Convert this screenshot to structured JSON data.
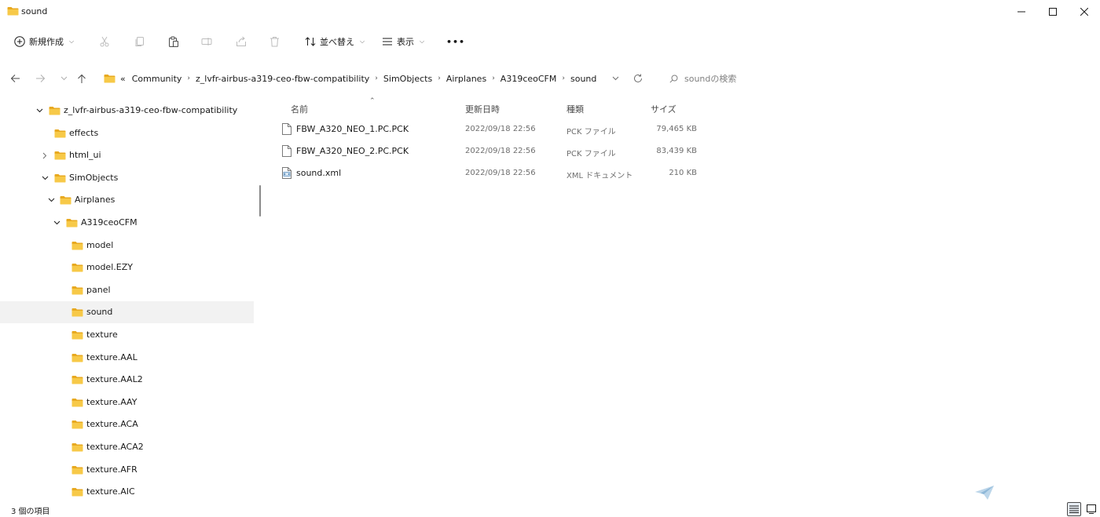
{
  "window": {
    "title": "sound",
    "controls": {
      "minimize": "minimize-icon",
      "maximize": "maximize-icon",
      "close": "close-icon"
    }
  },
  "toolbar": {
    "new_label": "新規作成",
    "sort_label": "並べ替え",
    "view_label": "表示",
    "more_label": "•••"
  },
  "address": {
    "crumbs": [
      "«",
      "Community",
      "z_lvfr-airbus-a319-ceo-fbw-compatibility",
      "SimObjects",
      "Airplanes",
      "A319ceoCFM",
      "sound"
    ],
    "search_placeholder": "soundの検索"
  },
  "nav_tree": [
    {
      "label": "z_lvfr-airbus-a319-ceo-fbw-compatibility",
      "depth": 0,
      "expander": "down"
    },
    {
      "label": "effects",
      "depth": 1,
      "expander": "none"
    },
    {
      "label": "html_ui",
      "depth": 1,
      "expander": "right"
    },
    {
      "label": "SimObjects",
      "depth": 1,
      "expander": "down"
    },
    {
      "label": "Airplanes",
      "depth": 2,
      "expander": "down"
    },
    {
      "label": "A319ceoCFM",
      "depth": 3,
      "expander": "down"
    },
    {
      "label": "model",
      "depth": 4,
      "expander": "none"
    },
    {
      "label": "model.EZY",
      "depth": 4,
      "expander": "none"
    },
    {
      "label": "panel",
      "depth": 4,
      "expander": "none"
    },
    {
      "label": "sound",
      "depth": 4,
      "expander": "none",
      "selected": true
    },
    {
      "label": "texture",
      "depth": 4,
      "expander": "none"
    },
    {
      "label": "texture.AAL",
      "depth": 4,
      "expander": "none"
    },
    {
      "label": "texture.AAL2",
      "depth": 4,
      "expander": "none"
    },
    {
      "label": "texture.AAY",
      "depth": 4,
      "expander": "none"
    },
    {
      "label": "texture.ACA",
      "depth": 4,
      "expander": "none"
    },
    {
      "label": "texture.ACA2",
      "depth": 4,
      "expander": "none"
    },
    {
      "label": "texture.AFR",
      "depth": 4,
      "expander": "none"
    },
    {
      "label": "texture.AIC",
      "depth": 4,
      "expander": "none"
    }
  ],
  "columns": {
    "name": "名前",
    "date": "更新日時",
    "type": "種類",
    "size": "サイズ"
  },
  "files": [
    {
      "name": "FBW_A320_NEO_1.PC.PCK",
      "date": "2022/09/18 22:56",
      "type": "PCK ファイル",
      "size": "79,465 KB",
      "icon": "file-icon"
    },
    {
      "name": "FBW_A320_NEO_2.PC.PCK",
      "date": "2022/09/18 22:56",
      "type": "PCK ファイル",
      "size": "83,439 KB",
      "icon": "file-icon"
    },
    {
      "name": "sound.xml",
      "date": "2022/09/18 22:56",
      "type": "XML ドキュメント",
      "size": "210 KB",
      "icon": "xml-file-icon"
    }
  ],
  "status": {
    "item_count": "3 個の項目"
  },
  "colors": {
    "folder": "#f7c948",
    "folder_dark": "#e8a920",
    "selected_bg": "#f2f2f2",
    "accent": "#4a90c8"
  }
}
